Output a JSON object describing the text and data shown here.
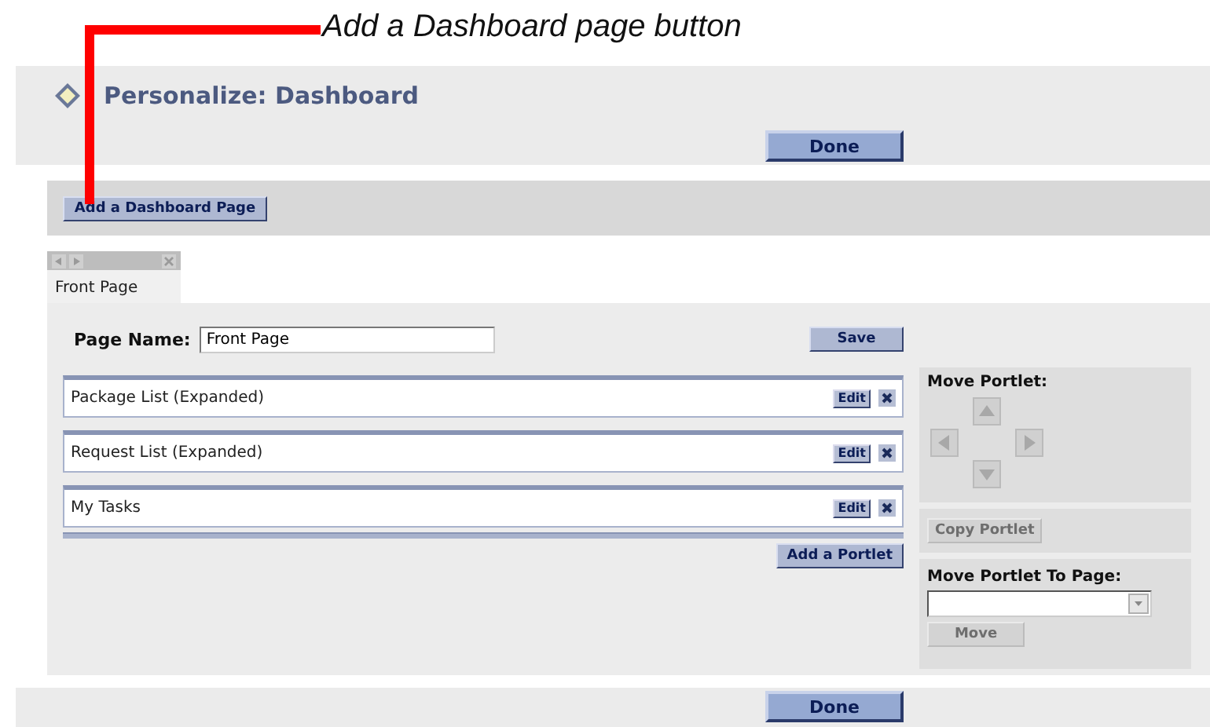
{
  "annotation": {
    "text": "Add a Dashboard page button"
  },
  "header": {
    "title": "Personalize: Dashboard",
    "done_button": "Done"
  },
  "toolbar": {
    "add_page_button": "Add a Dashboard Page"
  },
  "page_tabs": [
    {
      "label": "Front Page",
      "selected": true
    }
  ],
  "page_name": {
    "label": "Page Name:",
    "value": "Front Page"
  },
  "save_button": "Save",
  "portlets": [
    {
      "name": "Package List (Expanded)",
      "edit_button": "Edit"
    },
    {
      "name": "Request List (Expanded)",
      "edit_button": "Edit"
    },
    {
      "name": "My Tasks",
      "edit_button": "Edit"
    }
  ],
  "add_portlet_button": "Add a Portlet",
  "move_portlet": {
    "title": "Move Portlet:",
    "disabled": true
  },
  "copy_button": {
    "label": "Copy Portlet",
    "disabled": true
  },
  "move_to_page": {
    "title": "Move Portlet To Page:",
    "move_button": {
      "label": "Move",
      "disabled": true
    }
  },
  "footer": {
    "done_button": "Done"
  }
}
